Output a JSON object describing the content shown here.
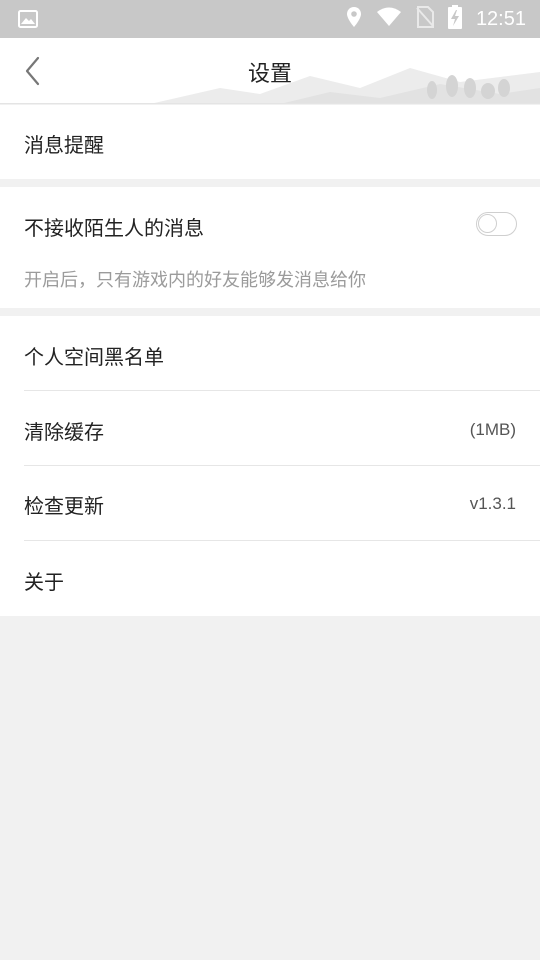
{
  "status_bar": {
    "time": "12:51",
    "icons": [
      "image-icon",
      "location-icon",
      "wifi-icon",
      "no-sim-icon",
      "battery-charging-icon"
    ]
  },
  "header": {
    "title": "设置",
    "back_icon": "chevron-left-icon"
  },
  "sections": {
    "notification": {
      "label": "消息提醒"
    },
    "stranger": {
      "label": "不接收陌生人的消息",
      "description": "开启后，只有游戏内的好友能够发消息给你",
      "toggle_on": false
    },
    "list": {
      "blacklist_label": "个人空间黑名单",
      "clear_cache_label": "清除缓存",
      "clear_cache_value": "(1MB)",
      "check_update_label": "检查更新",
      "check_update_value": "v1.3.1",
      "about_label": "关于"
    }
  },
  "colors": {
    "background": "#f1f1f1",
    "status_bar": "#c8c8c8",
    "text": "#222222",
    "muted": "#9b9b9b"
  }
}
